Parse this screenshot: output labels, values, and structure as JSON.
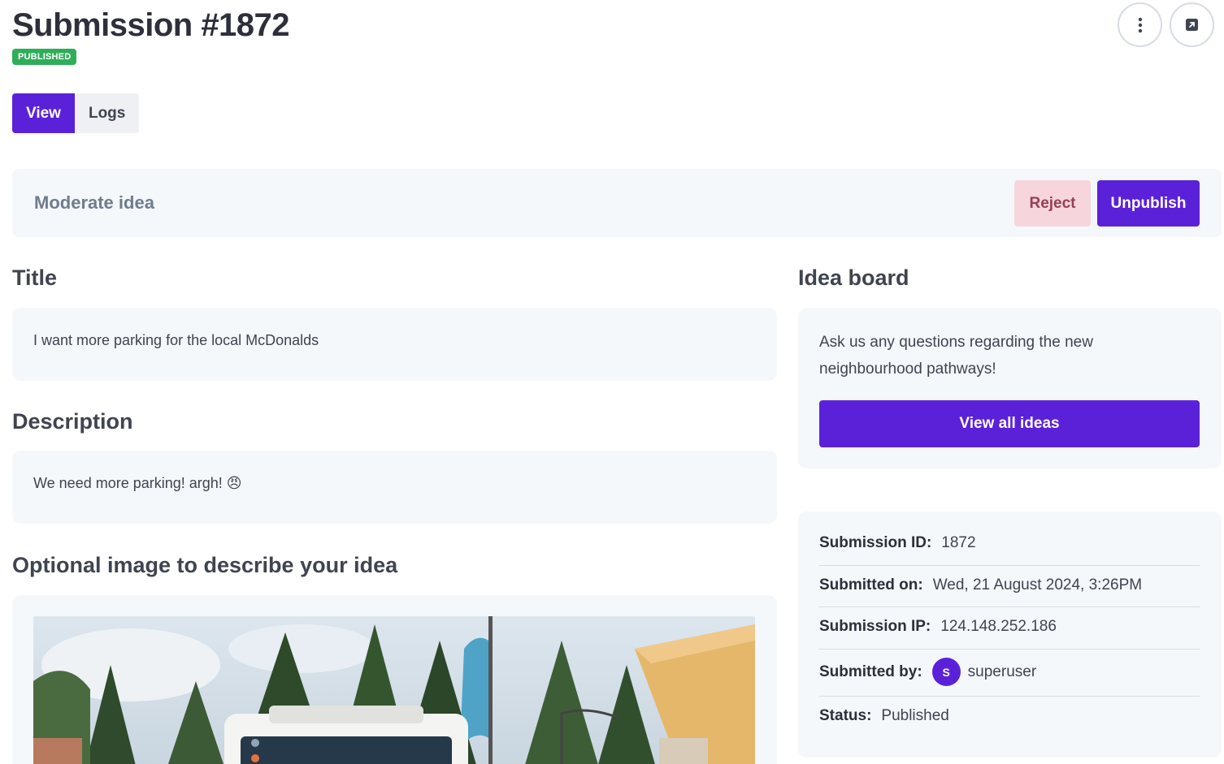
{
  "header": {
    "title": "Submission #1872",
    "status_badge": "PUBLISHED"
  },
  "tabs": [
    {
      "label": "View",
      "active": true
    },
    {
      "label": "Logs",
      "active": false
    }
  ],
  "moderation": {
    "label": "Moderate idea",
    "reject_label": "Reject",
    "unpublish_label": "Unpublish"
  },
  "fields": {
    "title_heading": "Title",
    "title_value": "I want more parking for the local McDonalds",
    "description_heading": "Description",
    "description_value": "We need more parking! argh! 😠",
    "image_heading": "Optional image to describe your idea"
  },
  "idea_board": {
    "heading": "Idea board",
    "text": "Ask us any questions regarding the new neighbourhood pathways!",
    "button_label": "View all ideas"
  },
  "meta": {
    "submission_id_label": "Submission ID:",
    "submission_id_value": "1872",
    "submitted_on_label": "Submitted on:",
    "submitted_on_value": "Wed, 21 August 2024, 3:26PM",
    "submission_ip_label": "Submission IP:",
    "submission_ip_value": "124.148.252.186",
    "submitted_by_label": "Submitted by:",
    "submitted_by_initial": "S",
    "submitted_by_value": "superuser",
    "status_label": "Status:",
    "status_value": "Published"
  },
  "colors": {
    "primary": "#5b21d9",
    "published_green": "#2fae5a",
    "reject_bg": "#f7d5dc",
    "card_bg": "#f5f8fb"
  }
}
